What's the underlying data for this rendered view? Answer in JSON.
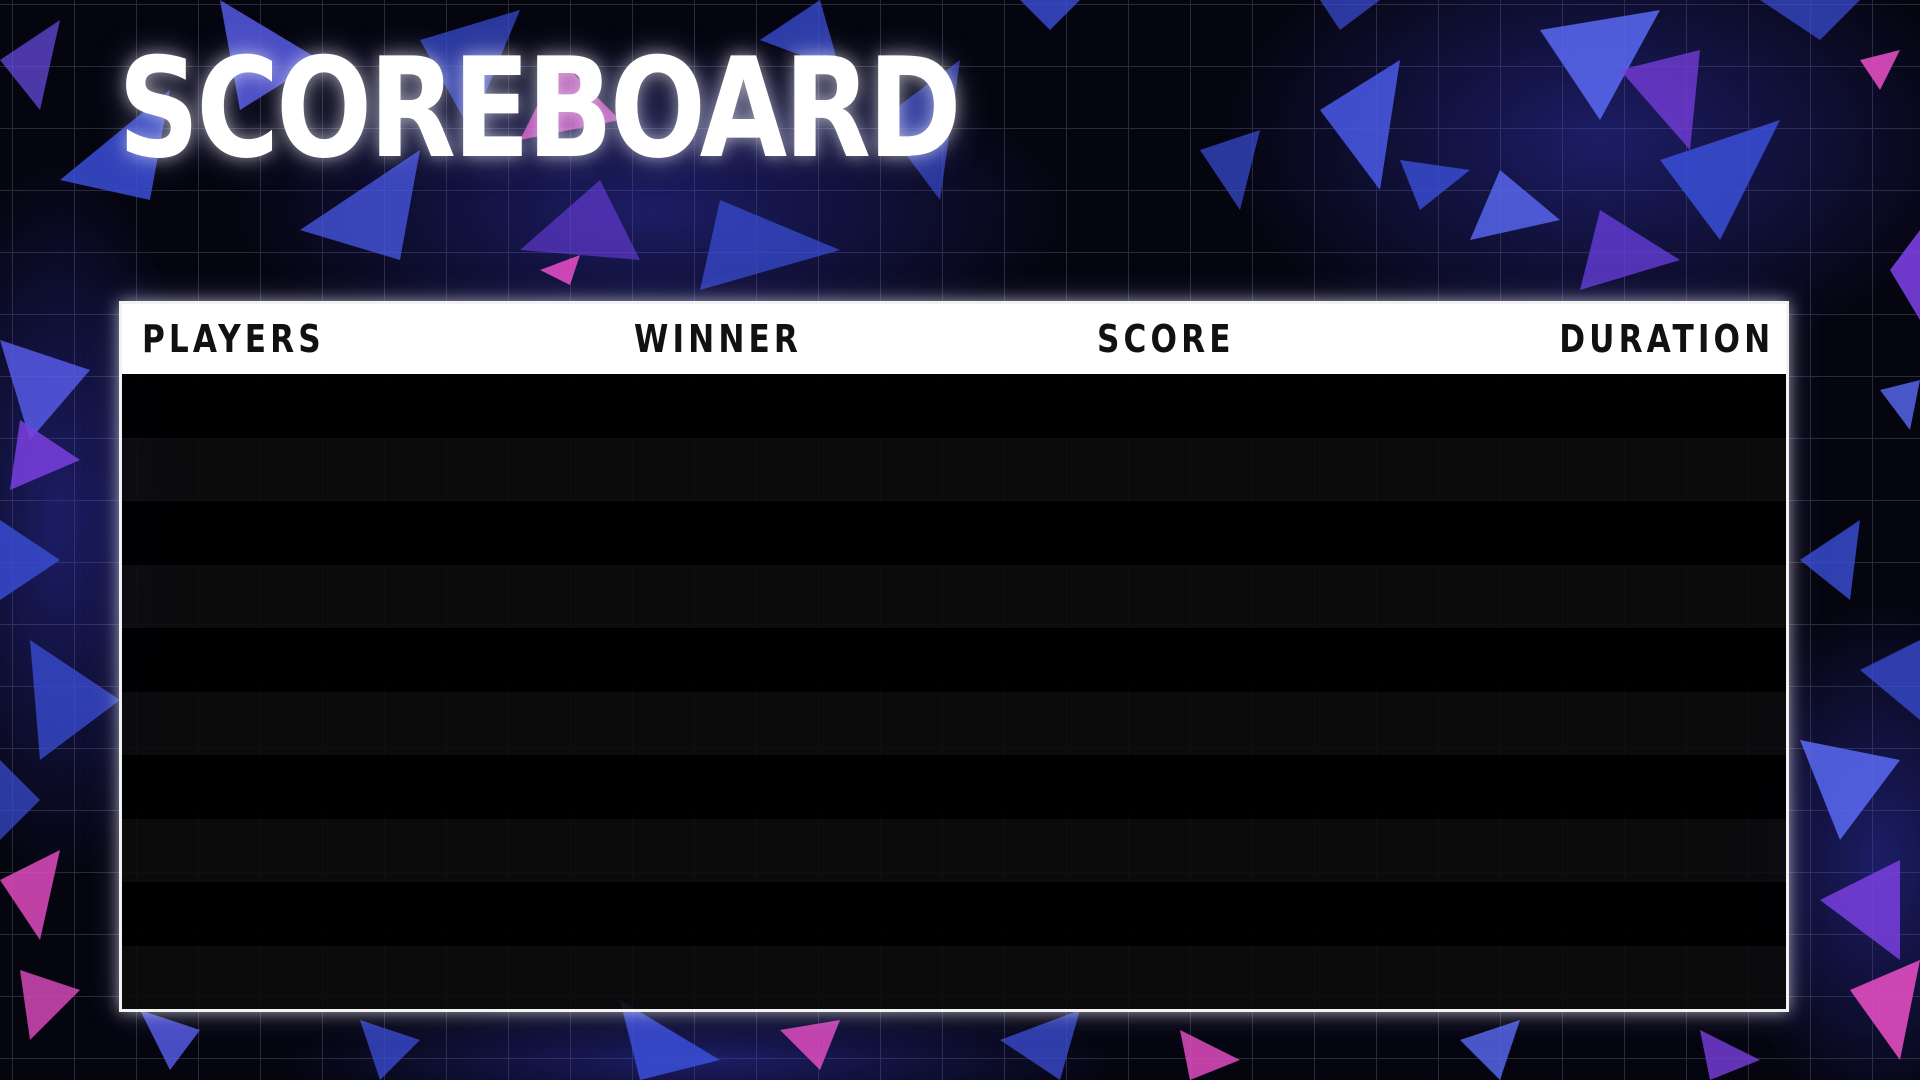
{
  "title": "SCOREBOARD",
  "columns": {
    "players": "PLAYERS",
    "winner": "WINNER",
    "score": "SCORE",
    "duration": "DURATION"
  },
  "rows": [
    {},
    {},
    {},
    {},
    {},
    {},
    {},
    {},
    {},
    {}
  ],
  "colors": {
    "background": "#050510",
    "grid": "#2a2a3a",
    "shard_blue": "#3b4fd8",
    "shard_violet": "#7a3fe0",
    "shard_pink": "#e04cc0",
    "header_bg": "#ffffff",
    "header_text": "#111111",
    "title_text": "#ffffff"
  }
}
